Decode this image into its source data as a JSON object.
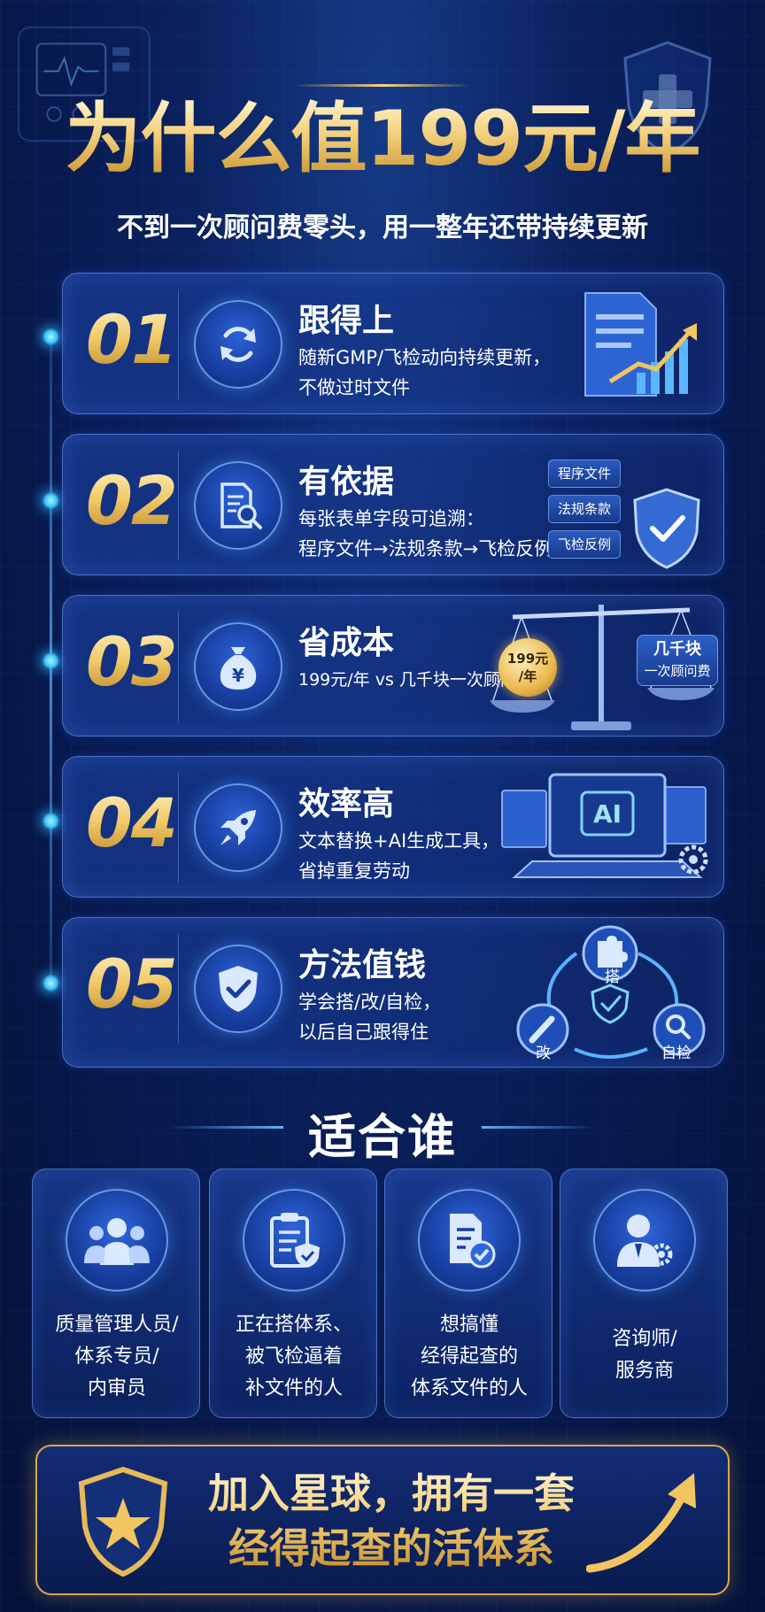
{
  "header": {
    "title": "为什么值199元/年",
    "subtitle": "不到一次顾问费零头，用一整年还带持续更新"
  },
  "benefits": [
    {
      "num": "01",
      "title": "跟得上",
      "desc": [
        "随新GMP/飞检动向持续更新，",
        "不做过时文件"
      ],
      "icon": "refresh-icon"
    },
    {
      "num": "02",
      "title": "有依据",
      "desc": [
        "每张表单字段可追溯：",
        "程序文件→法规条款→飞检反例"
      ],
      "icon": "document-search-icon",
      "tags": [
        "程序文件",
        "法规条款",
        "飞检反例"
      ]
    },
    {
      "num": "03",
      "title": "省成本",
      "desc": [
        "199元/年 vs 几千块一次顾问费"
      ],
      "icon": "money-bag-icon",
      "coin": [
        "199元",
        "/年"
      ],
      "pan": [
        "几千块",
        "一次顾问费"
      ]
    },
    {
      "num": "04",
      "title": "效率高",
      "desc": [
        "文本替换+AI生成工具，",
        "省掉重复劳动"
      ],
      "icon": "rocket-icon",
      "screen_label": "AI"
    },
    {
      "num": "05",
      "title": "方法值钱",
      "desc": [
        "学会搭/改/自检，",
        "以后自己跟得住"
      ],
      "icon": "shield-check-icon",
      "cycle": [
        "搭",
        "改",
        "自检"
      ]
    }
  ],
  "audience": {
    "title": "适合谁",
    "items": [
      {
        "lines": [
          "质量管理人员/",
          "体系专员/",
          "内审员"
        ],
        "icon": "people-group-icon"
      },
      {
        "lines": [
          "正在搭体系、",
          "被飞检逼着",
          "补文件的人"
        ],
        "icon": "clipboard-shield-icon"
      },
      {
        "lines": [
          "想搞懂",
          "经得起查的",
          "体系文件的人"
        ],
        "icon": "document-check-icon"
      },
      {
        "lines": [
          "咨询师/",
          "服务商"
        ],
        "icon": "consultant-gear-icon"
      }
    ]
  },
  "cta": {
    "lines": [
      "加入星球，拥有一套",
      "经得起查的活体系"
    ]
  },
  "colors": {
    "gold": "#f2cc72",
    "accent_blue": "#3cc6ff",
    "background": "#07184a"
  }
}
